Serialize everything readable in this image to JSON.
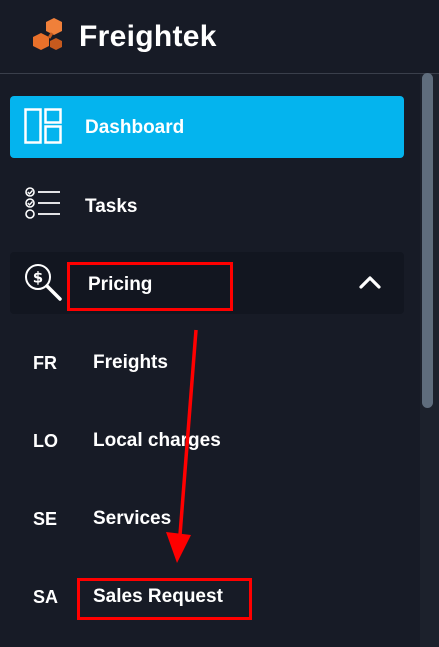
{
  "app": {
    "brand": "Freightek"
  },
  "sidebar": {
    "items": [
      {
        "label": "Dashboard",
        "icon": "dashboard-icon",
        "active": true
      },
      {
        "label": "Tasks",
        "icon": "tasks-checklist-icon"
      },
      {
        "label": "Pricing",
        "icon": "pricing-magnifier-icon",
        "expanded": true
      }
    ],
    "pricing_subitems": [
      {
        "abbr": "FR",
        "label": "Freights"
      },
      {
        "abbr": "LO",
        "label": "Local charges"
      },
      {
        "abbr": "SE",
        "label": "Services"
      },
      {
        "abbr": "SA",
        "label": "Sales Request"
      }
    ]
  },
  "colors": {
    "background": "#171b26",
    "active_item": "#04b4ee",
    "logo_orange": "#e8702a",
    "annotation_red": "#ff0000"
  }
}
